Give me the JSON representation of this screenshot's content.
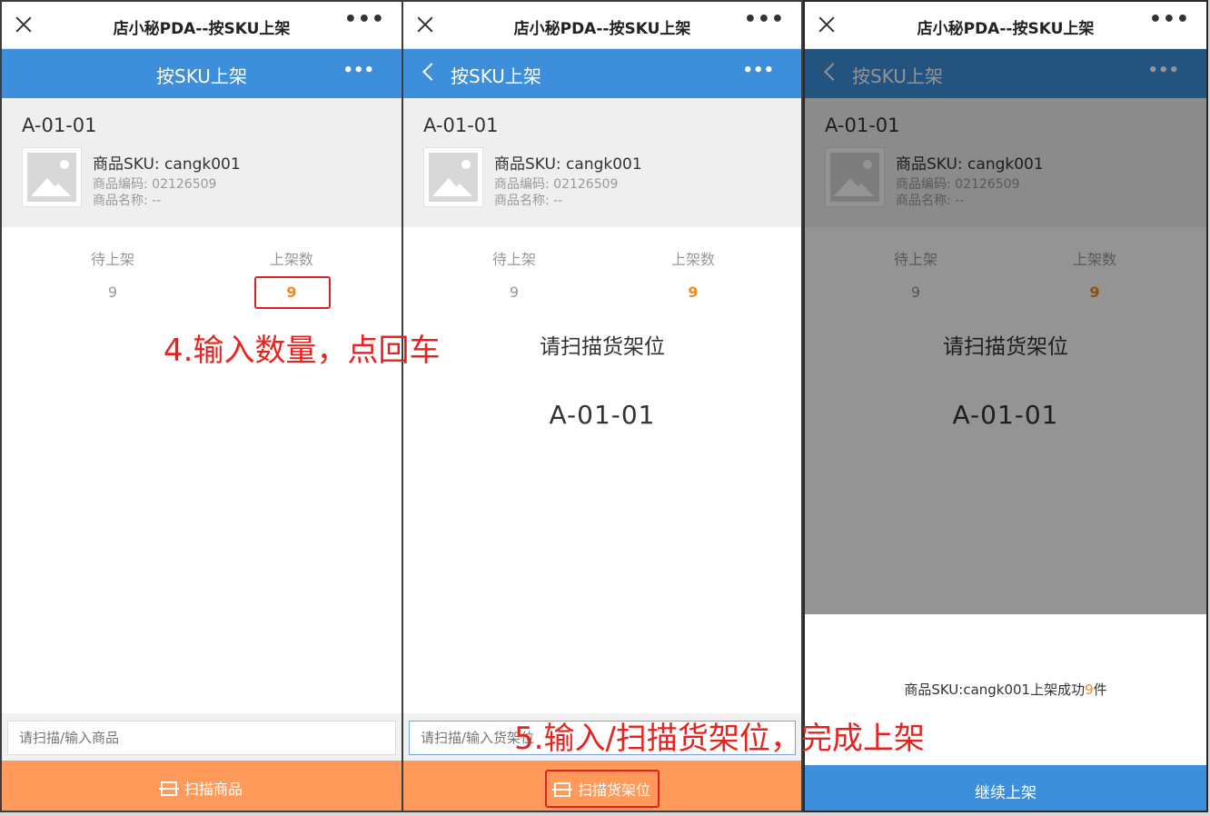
{
  "window_title": "店小秘PDA--按SKU上架",
  "nav_title": "按SKU上架",
  "location": "A-01-01",
  "product": {
    "sku": "商品SKU: cangk001",
    "code": "商品编码: 02126509",
    "name": "商品名称: --"
  },
  "counts": {
    "pending_label": "待上架",
    "pending_value": "9",
    "shelved_label": "上架数",
    "shelved_value": "9"
  },
  "scan_prompt": "请扫描货架位",
  "scan_location": "A-01-01",
  "screen1": {
    "input_placeholder": "请扫描/输入商品",
    "button_label": "扫描商品"
  },
  "screen2": {
    "input_placeholder": "请扫描/输入货架位",
    "button_label": "扫描货架位"
  },
  "screen3": {
    "message_prefix": "商品SKU:cangk001上架成功",
    "message_count": "9",
    "message_suffix": "件",
    "button_label": "继续上架"
  },
  "annotations": {
    "step4": "4.输入数量，点回车",
    "step5": "5.输入/扫描货架位，完成上架"
  },
  "colors": {
    "nav_blue": "#3d8fdb",
    "button_orange": "#ff9a5a",
    "highlight_red": "#e02020",
    "value_orange": "#f08a1c"
  }
}
